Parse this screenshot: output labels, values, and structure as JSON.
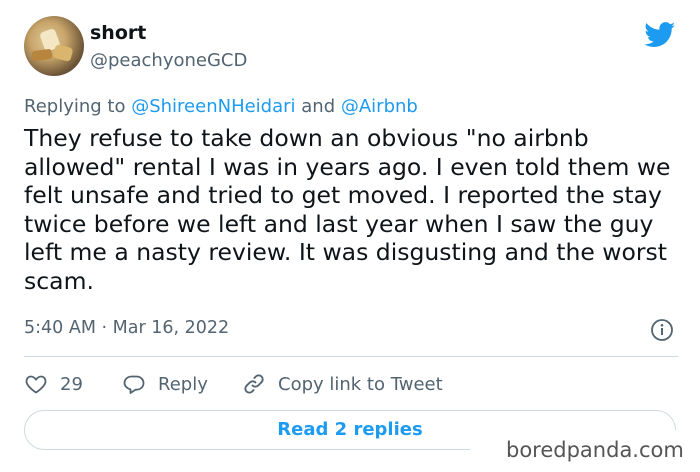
{
  "user": {
    "display_name": "short",
    "handle": "@peachyoneGCD"
  },
  "reply": {
    "prefix": "Replying to ",
    "mention1": "@ShireenNHeidari",
    "joiner": " and ",
    "mention2": "@Airbnb"
  },
  "tweet": {
    "text": "They refuse to take down an obvious \"no airbnb allowed\" rental I was in years ago. I even told them we felt unsafe and tried to get moved. I reported the stay twice before we left and last year when I saw the guy left me a nasty review. It was disgusting and the worst scam.",
    "timestamp": "5:40 AM · Mar 16, 2022"
  },
  "actions": {
    "like_count": "29",
    "reply_label": "Reply",
    "copy_label": "Copy link to Tweet"
  },
  "read_more": {
    "label": "Read 2 replies"
  },
  "watermark": "boredpanda.com",
  "icons": [
    "avatar-image",
    "twitter-bird-icon",
    "info-icon",
    "heart-icon",
    "reply-bubble-icon",
    "link-icon"
  ],
  "colors": {
    "accent": "#1d9bf0",
    "secondary_text": "#536471",
    "primary_text": "#0f1419",
    "divider": "#cfd9de"
  }
}
